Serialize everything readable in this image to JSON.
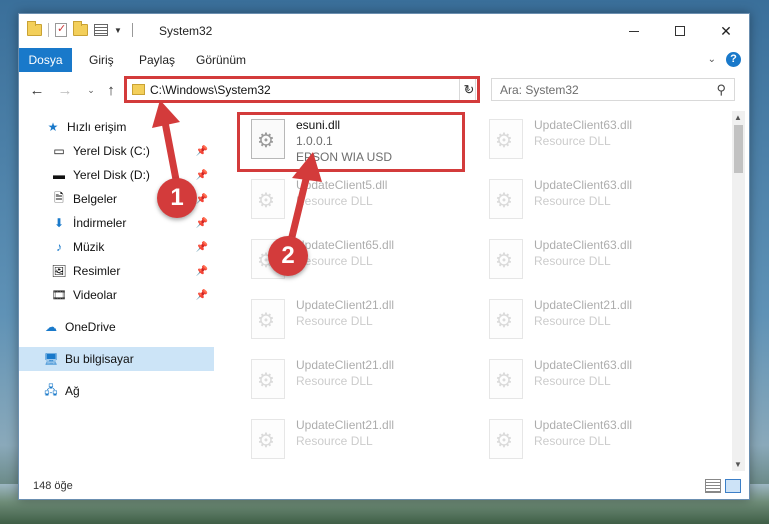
{
  "titlebar": {
    "title": "System32"
  },
  "ribbon": {
    "tabs": [
      "Dosya",
      "Giriş",
      "Paylaş",
      "Görünüm"
    ],
    "help": "?"
  },
  "address": {
    "path": "C:\\Windows\\System32"
  },
  "search": {
    "placeholder": "Ara: System32"
  },
  "sidebar": {
    "quick_access": "Hızlı erişim",
    "items": [
      "Yerel Disk (C:)",
      "Yerel Disk (D:)",
      "Belgeler",
      "İndirmeler",
      "Müzik",
      "Resimler",
      "Videolar"
    ],
    "onedrive": "OneDrive",
    "this_pc": "Bu bilgisayar",
    "network": "Ağ"
  },
  "files": {
    "highlighted": {
      "name": "esuni.dll",
      "version": "1.0.0.1",
      "description": "EPSON WIA USD"
    },
    "left_column": [
      {
        "name": "UpdateClient5.dll",
        "description": "Resource DLL"
      },
      {
        "name": "UpdateClient65.dll",
        "description": "Resource DLL"
      },
      {
        "name": "UpdateClient21.dll",
        "description": "Resource DLL"
      },
      {
        "name": "UpdateClient21.dll",
        "description": "Resource DLL"
      },
      {
        "name": "UpdateClient21.dll",
        "description": "Resource DLL"
      }
    ],
    "right_column": [
      {
        "name": "UpdateClient63.dll",
        "description": "Resource DLL"
      },
      {
        "name": "UpdateClient63.dll",
        "description": "Resource DLL"
      },
      {
        "name": "UpdateClient63.dll",
        "description": "Resource DLL"
      },
      {
        "name": "UpdateClient21.dll",
        "description": "Resource DLL"
      },
      {
        "name": "UpdateClient63.dll",
        "description": "Resource DLL"
      },
      {
        "name": "UpdateClient63.dll",
        "description": "Resource DLL"
      }
    ]
  },
  "status": {
    "count": "148 öğe"
  },
  "annotations": {
    "step1": "1",
    "step2": "2",
    "color": "#d33b3b"
  },
  "colors": {
    "accent": "#1979ca",
    "selection": "#cce4f7"
  }
}
